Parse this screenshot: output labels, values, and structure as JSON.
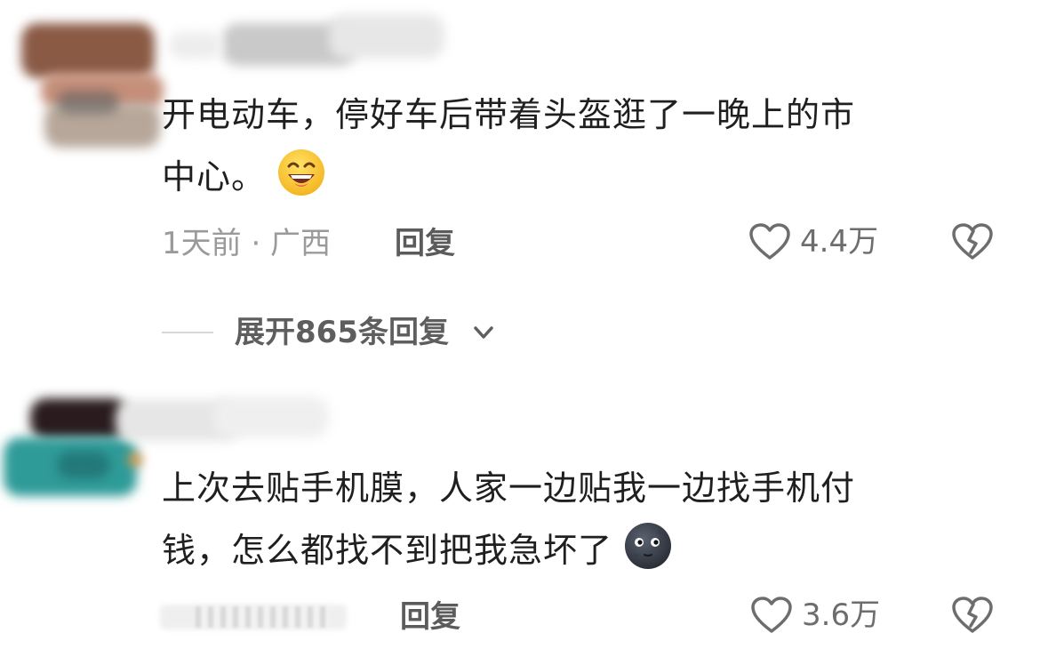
{
  "comments": [
    {
      "text_lines": [
        "开电动车，停好车后带着头盔逛了一晚上的市",
        "中心。"
      ],
      "emoji": "grinning-sweat-smile-emoji",
      "meta": "1天前 · 广西",
      "reply_label": "回复",
      "likes": "4.4万"
    },
    {
      "text_lines": [
        "上次去贴手机膜，人家一边贴我一边找手机付",
        "钱，怎么都找不到把我急坏了"
      ],
      "emoji": "new-moon-face-emoji",
      "reply_label": "回复",
      "likes": "3.6万"
    }
  ],
  "expand_replies_label": "展开865条回复",
  "icons": {
    "like": "heart-outline-icon",
    "dislike": "broken-heart-icon",
    "expand": "chevron-down-icon"
  },
  "colors": {
    "text": "#1f1f1f",
    "meta": "#9a9a9a",
    "reply": "#5b5b5b",
    "icon": "#6d6d6d",
    "divider": "#d8d8d8"
  }
}
